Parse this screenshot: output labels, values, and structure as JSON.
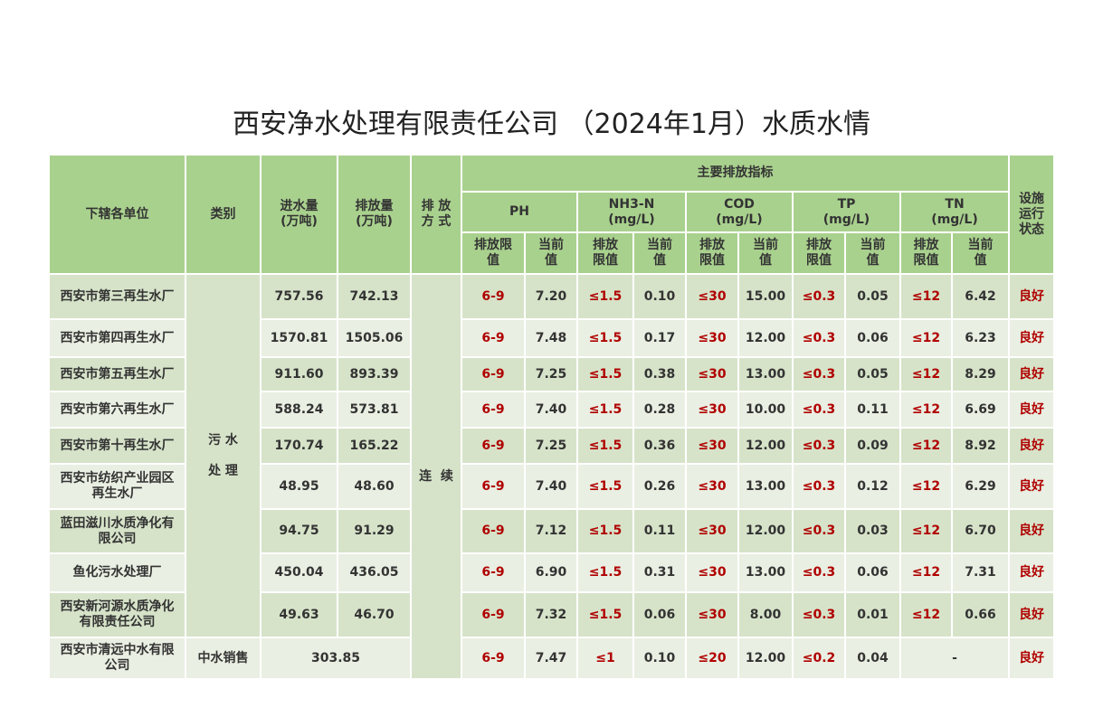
{
  "title": "西安净水处理有限责任公司 （2024年1月）水质水情",
  "headers": {
    "unit": "下辖各单位",
    "category": "类别",
    "inflow": "进水量\n(万吨)",
    "discharge": "排放量\n(万吨)",
    "method": "排 放\n方 式",
    "main_indicators": "主要排放指标",
    "ph": "PH",
    "nh3n": "NH3-N\n(mg/L)",
    "cod": "COD\n(mg/L)",
    "tp": "TP\n(mg/L)",
    "tn": "TN\n(mg/L)",
    "status": "设施\n运行\n状态",
    "limit": "排放限\n值",
    "current": "当前\n值",
    "limit2": "排放\n限值"
  },
  "category_sewage": "污 水\n\n处 理",
  "category_reclaimed": "中水销售",
  "method_value": "连  续",
  "rows": [
    {
      "name": "西安市第三再生水厂",
      "inflow": "757.56",
      "discharge": "742.13",
      "ph_limit": "6-9",
      "ph": "7.20",
      "nh3_limit": "≤1.5",
      "nh3": "0.10",
      "cod_limit": "≤30",
      "cod": "15.00",
      "tp_limit": "≤0.3",
      "tp": "0.05",
      "tn_limit": "≤12",
      "tn": "6.42",
      "status": "良好"
    },
    {
      "name": "西安市第四再生水厂",
      "inflow": "1570.81",
      "discharge": "1505.06",
      "ph_limit": "6-9",
      "ph": "7.48",
      "nh3_limit": "≤1.5",
      "nh3": "0.17",
      "cod_limit": "≤30",
      "cod": "12.00",
      "tp_limit": "≤0.3",
      "tp": "0.06",
      "tn_limit": "≤12",
      "tn": "6.23",
      "status": "良好"
    },
    {
      "name": "西安市第五再生水厂",
      "inflow": "911.60",
      "discharge": "893.39",
      "ph_limit": "6-9",
      "ph": "7.25",
      "nh3_limit": "≤1.5",
      "nh3": "0.38",
      "cod_limit": "≤30",
      "cod": "13.00",
      "tp_limit": "≤0.3",
      "tp": "0.05",
      "tn_limit": "≤12",
      "tn": "8.29",
      "status": "良好"
    },
    {
      "name": "西安市第六再生水厂",
      "inflow": "588.24",
      "discharge": "573.81",
      "ph_limit": "6-9",
      "ph": "7.40",
      "nh3_limit": "≤1.5",
      "nh3": "0.28",
      "cod_limit": "≤30",
      "cod": "10.00",
      "tp_limit": "≤0.3",
      "tp": "0.11",
      "tn_limit": "≤12",
      "tn": "6.69",
      "status": "良好"
    },
    {
      "name": "西安市第十再生水厂",
      "inflow": "170.74",
      "discharge": "165.22",
      "ph_limit": "6-9",
      "ph": "7.25",
      "nh3_limit": "≤1.5",
      "nh3": "0.36",
      "cod_limit": "≤30",
      "cod": "12.00",
      "tp_limit": "≤0.3",
      "tp": "0.09",
      "tn_limit": "≤12",
      "tn": "8.92",
      "status": "良好"
    },
    {
      "name": "西安市纺织产业园区\n再生水厂",
      "inflow": "48.95",
      "discharge": "48.60",
      "ph_limit": "6-9",
      "ph": "7.40",
      "nh3_limit": "≤1.5",
      "nh3": "0.26",
      "cod_limit": "≤30",
      "cod": "13.00",
      "tp_limit": "≤0.3",
      "tp": "0.12",
      "tn_limit": "≤12",
      "tn": "6.29",
      "status": "良好"
    },
    {
      "name": "蓝田滋川水质净化有\n限公司",
      "inflow": "94.75",
      "discharge": "91.29",
      "ph_limit": "6-9",
      "ph": "7.12",
      "nh3_limit": "≤1.5",
      "nh3": "0.11",
      "cod_limit": "≤30",
      "cod": "12.00",
      "tp_limit": "≤0.3",
      "tp": "0.03",
      "tn_limit": "≤12",
      "tn": "6.70",
      "status": "良好"
    },
    {
      "name": "鱼化污水处理厂",
      "inflow": "450.04",
      "discharge": "436.05",
      "ph_limit": "6-9",
      "ph": "6.90",
      "nh3_limit": "≤1.5",
      "nh3": "0.31",
      "cod_limit": "≤30",
      "cod": "13.00",
      "tp_limit": "≤0.3",
      "tp": "0.06",
      "tn_limit": "≤12",
      "tn": "7.31",
      "status": "良好"
    },
    {
      "name": "西安新河源水质净化\n有限责任公司",
      "inflow": "49.63",
      "discharge": "46.70",
      "ph_limit": "6-9",
      "ph": "7.32",
      "nh3_limit": "≤1.5",
      "nh3": "0.06",
      "cod_limit": "≤30",
      "cod": "8.00",
      "tp_limit": "≤0.3",
      "tp": "0.01",
      "tn_limit": "≤12",
      "tn": "0.66",
      "status": "良好"
    }
  ],
  "last_row": {
    "name": "西安市清远中水有限\n公司",
    "volume": "303.85",
    "ph_limit": "6-9",
    "ph": "7.47",
    "nh3_limit": "≤1",
    "nh3": "0.10",
    "cod_limit": "≤20",
    "cod": "12.00",
    "tp_limit": "≤0.2",
    "tp": "0.04",
    "tn": "-",
    "status": "良好"
  }
}
